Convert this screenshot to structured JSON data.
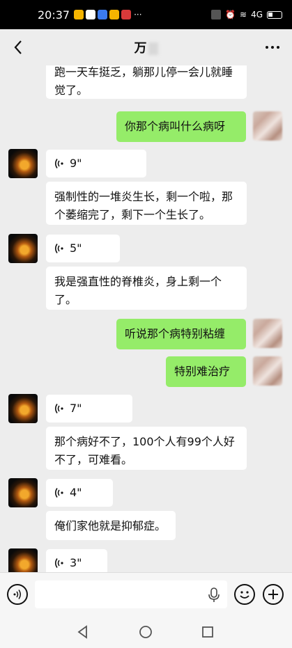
{
  "status_bar": {
    "time": "20:37",
    "overflow": "···",
    "signal_text": "4G"
  },
  "header": {
    "title": "万",
    "more": "···"
  },
  "messages": [
    {
      "side": "in",
      "kind": "text",
      "text": "跑一天车挺乏，躺那儿停一会儿就睡觉了。"
    },
    {
      "side": "out",
      "kind": "text",
      "text": "你那个病叫什么病呀"
    },
    {
      "side": "in",
      "kind": "voice",
      "duration": "9\""
    },
    {
      "side": "in",
      "kind": "text",
      "text": "强制性的一堆炎生长，剩一个啦，那个萎缩完了，剩下一个生长了。"
    },
    {
      "side": "in",
      "kind": "voice",
      "duration": "5\""
    },
    {
      "side": "in",
      "kind": "text",
      "text": "我是强直性的脊椎炎，身上剩一个了。"
    },
    {
      "side": "out",
      "kind": "text",
      "text": "听说那个病特别粘缠"
    },
    {
      "side": "out",
      "kind": "text",
      "text": "特别难治疗"
    },
    {
      "side": "in",
      "kind": "voice",
      "duration": "7\""
    },
    {
      "side": "in",
      "kind": "text",
      "text": "那个病好不了，100个人有99个人好不了，可难看。"
    },
    {
      "side": "in",
      "kind": "voice",
      "duration": "4\""
    },
    {
      "side": "in",
      "kind": "text",
      "text": "俺们家他就是抑郁症。"
    },
    {
      "side": "in",
      "kind": "voice",
      "duration": "3\""
    }
  ],
  "input": {
    "value": "",
    "placeholder": ""
  },
  "colors": {
    "out_bubble": "#95ec69",
    "in_bubble": "#ffffff",
    "background": "#ededed"
  }
}
